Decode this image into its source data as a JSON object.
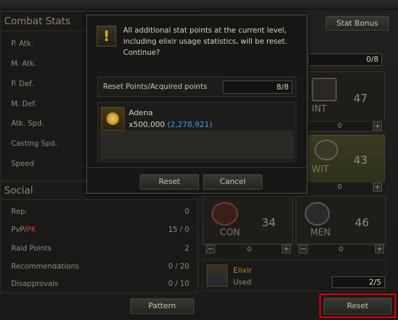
{
  "combat": {
    "title": "Combat Stats",
    "rows": [
      {
        "label": "P. Atk.",
        "value": ""
      },
      {
        "label": "M. Atk.",
        "value": ""
      },
      {
        "label": "P. Def.",
        "value": ""
      },
      {
        "label": "M. Def.",
        "value": ""
      },
      {
        "label": "Atk. Spd.",
        "value": ""
      },
      {
        "label": "Casting Spd.",
        "value": ""
      },
      {
        "label": "Speed",
        "value": ""
      }
    ]
  },
  "social": {
    "title": "Social",
    "rows": [
      {
        "label": "Rep.",
        "value": "0"
      },
      {
        "label": "PvP/",
        "label_pk": "PK",
        "value": "15 / 0"
      },
      {
        "label": "Raid Points",
        "value": "2"
      },
      {
        "label": "Recommendations",
        "value": "0 / 20"
      },
      {
        "label": "Disapprovals",
        "value": "0 / 10"
      }
    ]
  },
  "buttons": {
    "stat_bonus": "Stat Bonus",
    "pattern": "Pattern",
    "reset_main": "Reset"
  },
  "points_value": "0/8",
  "stats": [
    {
      "name": "INT",
      "value": "47",
      "bar": "0"
    },
    {
      "name": "WIT",
      "value": "43",
      "bar": "0"
    },
    {
      "name": "CON",
      "value": "34",
      "bar": "0"
    },
    {
      "name": "MEN",
      "value": "46",
      "bar": "0"
    }
  ],
  "elixir": {
    "title": "Elixir",
    "used_label": "Used",
    "used_value": "2/5"
  },
  "dialog": {
    "message": "All additional stat points at the current level, including elixir usage statistics, will be reset. Continue?",
    "reset_points_label": "Reset Points/Acquired points",
    "reset_points_value": "8/8",
    "item_name": "Adena",
    "item_cost": "x500,000",
    "item_owned": "(2,278,921)",
    "reset_button": "Reset",
    "cancel_button": "Cancel"
  },
  "colors": {
    "pk": "#c0392b",
    "owned": "#3fa0e6",
    "highlight": "#e00000"
  }
}
